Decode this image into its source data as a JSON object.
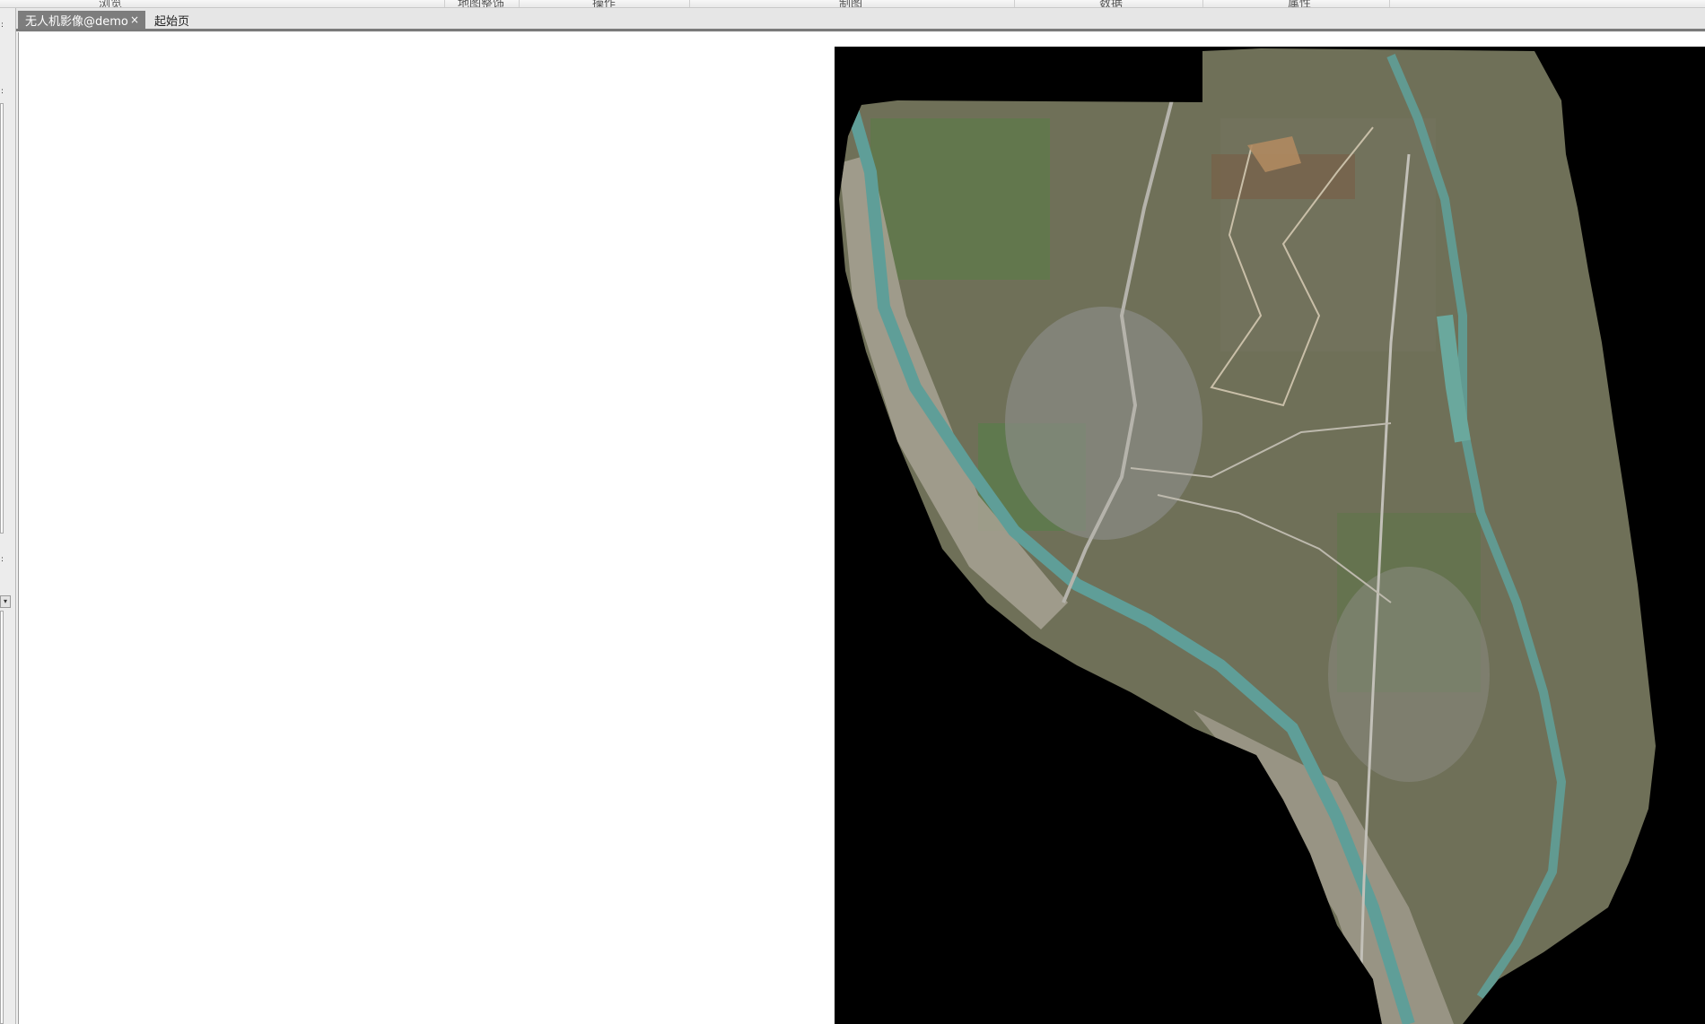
{
  "ribbon": {
    "groups": [
      "浏览",
      "地图整饰",
      "操作",
      "制图",
      "数据",
      "属性"
    ]
  },
  "tabs": [
    {
      "label": "无人机影像@demo",
      "active": true
    },
    {
      "label": "起始页",
      "active": false
    }
  ],
  "tab_close_glyph": "×",
  "left_panel": {
    "markers": [
      ":",
      ":",
      ":"
    ],
    "scroll_glyph": "▾"
  },
  "map": {
    "layer_name": "无人机影像@demo",
    "background_color": "#000000",
    "river_color": "#5f9e98",
    "land_color": "#6f7058",
    "farmland_color": "#5e7a4a",
    "sand_color": "#a8a294"
  }
}
